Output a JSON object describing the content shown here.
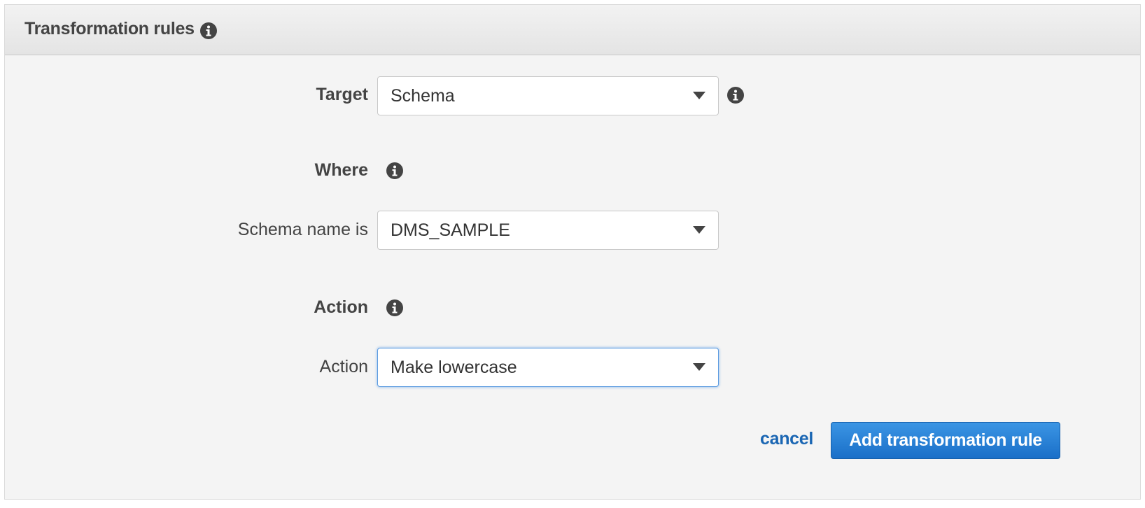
{
  "header": {
    "title": "Transformation rules",
    "info_icon": "info-icon"
  },
  "form": {
    "target": {
      "label": "Target",
      "value": "Schema",
      "info_icon": "info-icon"
    },
    "where": {
      "heading": "Where",
      "info_icon": "info-icon"
    },
    "schema_name": {
      "label": "Schema name is",
      "value": "DMS_SAMPLE"
    },
    "action_section": {
      "heading": "Action",
      "info_icon": "info-icon"
    },
    "action": {
      "label": "Action",
      "value": "Make lowercase"
    }
  },
  "footer": {
    "cancel_label": "cancel",
    "submit_label": "Add transformation rule"
  },
  "colors": {
    "panel_background": "#f4f4f4",
    "header_background": "#e8e8e8",
    "link": "#1a66b3",
    "primary_button": "#1f74cc",
    "focus_border": "#5a9ae0",
    "text": "#444444"
  }
}
